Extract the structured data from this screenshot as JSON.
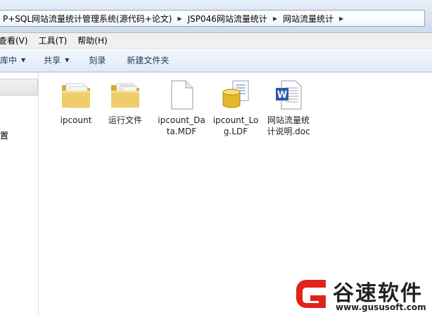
{
  "breadcrumb": {
    "items": [
      "P+SQL网站流量统计管理系统(源代码+论文)",
      "JSP046网站流量统计",
      "网站流量统计"
    ]
  },
  "menu": {
    "items": [
      "查看(V)",
      "工具(T)",
      "帮助(H)"
    ]
  },
  "toolbar": {
    "include_label": "库中",
    "share_label": "共享",
    "burn_label": "刻录",
    "new_folder_label": "新建文件夹"
  },
  "navpane": {
    "partial_label": "置"
  },
  "files": [
    {
      "name": "ipcount",
      "icon": "folder-icon"
    },
    {
      "name": "运行文件",
      "icon": "folder-icon"
    },
    {
      "name": "ipcount_Data.MDF",
      "icon": "document-icon"
    },
    {
      "name": "ipcount_Log.LDF",
      "icon": "database-icon"
    },
    {
      "name": "网站流量统计说明.doc",
      "icon": "word-document-icon"
    }
  ],
  "watermark": {
    "brand": "谷速软件",
    "url": "www.gususoft.com",
    "accent": "#e2231a"
  },
  "colors": {
    "toolbar_text": "#1e395b",
    "folder": "#e8c25a"
  }
}
